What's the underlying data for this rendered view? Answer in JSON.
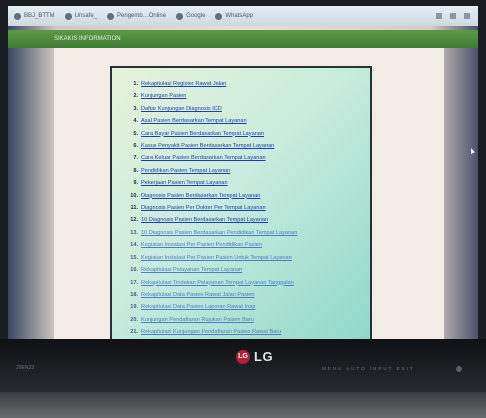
{
  "browser": {
    "bookmarks": [
      "BBJ_BTTM",
      "Unsafe_",
      "Pengemb…Online",
      "Google",
      "WhatsApp"
    ],
    "tab_title": "SIKAKIS INFORMATION"
  },
  "menu": {
    "items": [
      {
        "num": "1.",
        "label": "Rekapitulasi Register Rawat Jalan"
      },
      {
        "num": "2.",
        "label": "Kunjungan Pasien"
      },
      {
        "num": "3.",
        "label": "Daftar Kunjungan Diagnosis ICD"
      },
      {
        "num": "4.",
        "label": "Asal Pasien Berdasarkan Tempat Layanan"
      },
      {
        "num": "5.",
        "label": "Cara Bayar Pasien Berdasarkan Tempat Layanan"
      },
      {
        "num": "6.",
        "label": "Kasus Penyakit Pasien Berdasarkan Tempat Layanan"
      },
      {
        "num": "7.",
        "label": "Cara Keluar Pasien Berdasarkan Tempat Layanan"
      },
      {
        "num": "8.",
        "label": "Pendidikan Pasien Tempat Layanan"
      },
      {
        "num": "9.",
        "label": "Pekerjaan Pasien Tempat Layanan"
      },
      {
        "num": "10.",
        "label": "Diagnosis Pasien Berdasarkan Tempat Layanan"
      },
      {
        "num": "11.",
        "label": "Diagnosis Pasien Per Dokter Per Tempat Layanan"
      },
      {
        "num": "12.",
        "label": "10 Diagnosis Pasien Berdasarkan Tempat Layanan"
      },
      {
        "num": "13.",
        "label": "10 Diagnosis Pasien Berdasarkan Pendidikan Tempat Layanan"
      },
      {
        "num": "14.",
        "label": "Kegiatan Instalasi Per Pasien Pendidikan Pasien"
      },
      {
        "num": "15.",
        "label": "Kegiatan Instalasi Per Pasien Pasien Untuk Tempat Layanan"
      },
      {
        "num": "16.",
        "label": "Rekapitulasi Pelayanan Tempat Layanan"
      },
      {
        "num": "17.",
        "label": "Rekapitulasi Tindakan Pelayanan Tempat Layanan Tanggalan"
      },
      {
        "num": "18.",
        "label": "Rekapitulasi Data Pasien Rawat Jalan Pasien"
      },
      {
        "num": "19.",
        "label": "Rekapitulasi Data Pasien Laporan Rawat Inap"
      },
      {
        "num": "20.",
        "label": "Kunjungan Pendaftaran Rujukan Pasien Baru"
      },
      {
        "num": "21.",
        "label": "Rekapitulasi Kunjungan Pendaftaran Pasien Rawat Baru"
      }
    ],
    "faint_from": 12
  },
  "monitor": {
    "brand": "LG",
    "brand_mark": "LG",
    "model": "20EN33",
    "controls": "MENU  AUTO  INPUT  EXIT"
  },
  "colors": {
    "panel_border": "#253236",
    "link": "#1b3fb0",
    "tab_green": "#4f8b3c",
    "lg_red": "#b32035"
  }
}
